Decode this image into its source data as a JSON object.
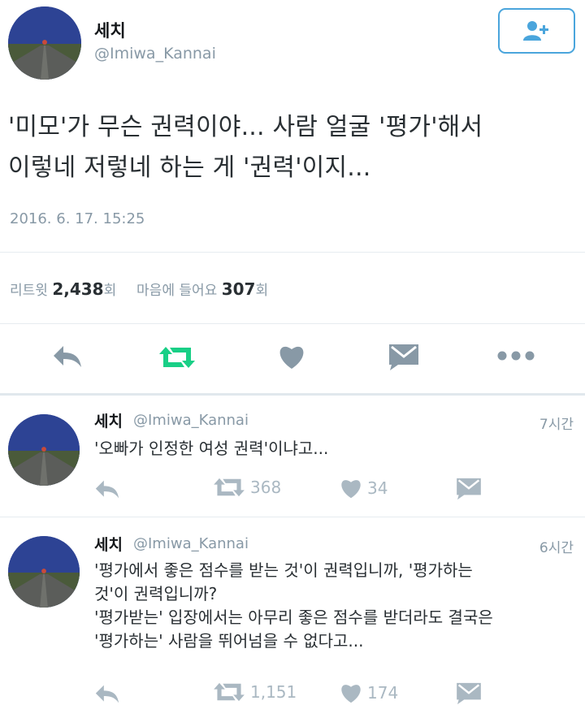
{
  "main_tweet": {
    "author_name": "세치",
    "handle": "@Imiwa_Kannai",
    "text_line1": "'미모'가 무슨 권력이야... 사람 얼굴 '평가'해서",
    "text_line2": "이렇네 저렇네 하는 게 '권력'이지...",
    "timestamp": "2016. 6. 17. 15:25",
    "retweet_label": "리트윗",
    "retweet_count": "2,438",
    "count_suffix": "회",
    "like_label": "마음에 들어요",
    "like_count": "307",
    "follow_icon": "add-user-icon"
  },
  "replies": [
    {
      "author_name": "세치",
      "handle": "@Imiwa_Kannai",
      "time": "7시간",
      "lines": [
        "'오빠가 인정한 여성 권력'이냐고..."
      ],
      "retweets": "368",
      "likes": "34"
    },
    {
      "author_name": "세치",
      "handle": "@Imiwa_Kannai",
      "time": "6시간",
      "lines": [
        "'평가에서 좋은 점수를 받는 것'이 권력입니까, '평가하는",
        "것'이 권력입니까?",
        "'평가받는' 입장에서는 아무리 좋은 점수를 받더라도 결국은",
        "'평가하는' 사람을 뛰어넘을 수 없다고..."
      ],
      "retweets": "1,151",
      "likes": "174"
    }
  ],
  "colors": {
    "accent_blue": "#4aa5dc",
    "retweet_green": "#19cf86",
    "icon_grey": "#8899a6",
    "light_grey": "#aab8c2"
  }
}
